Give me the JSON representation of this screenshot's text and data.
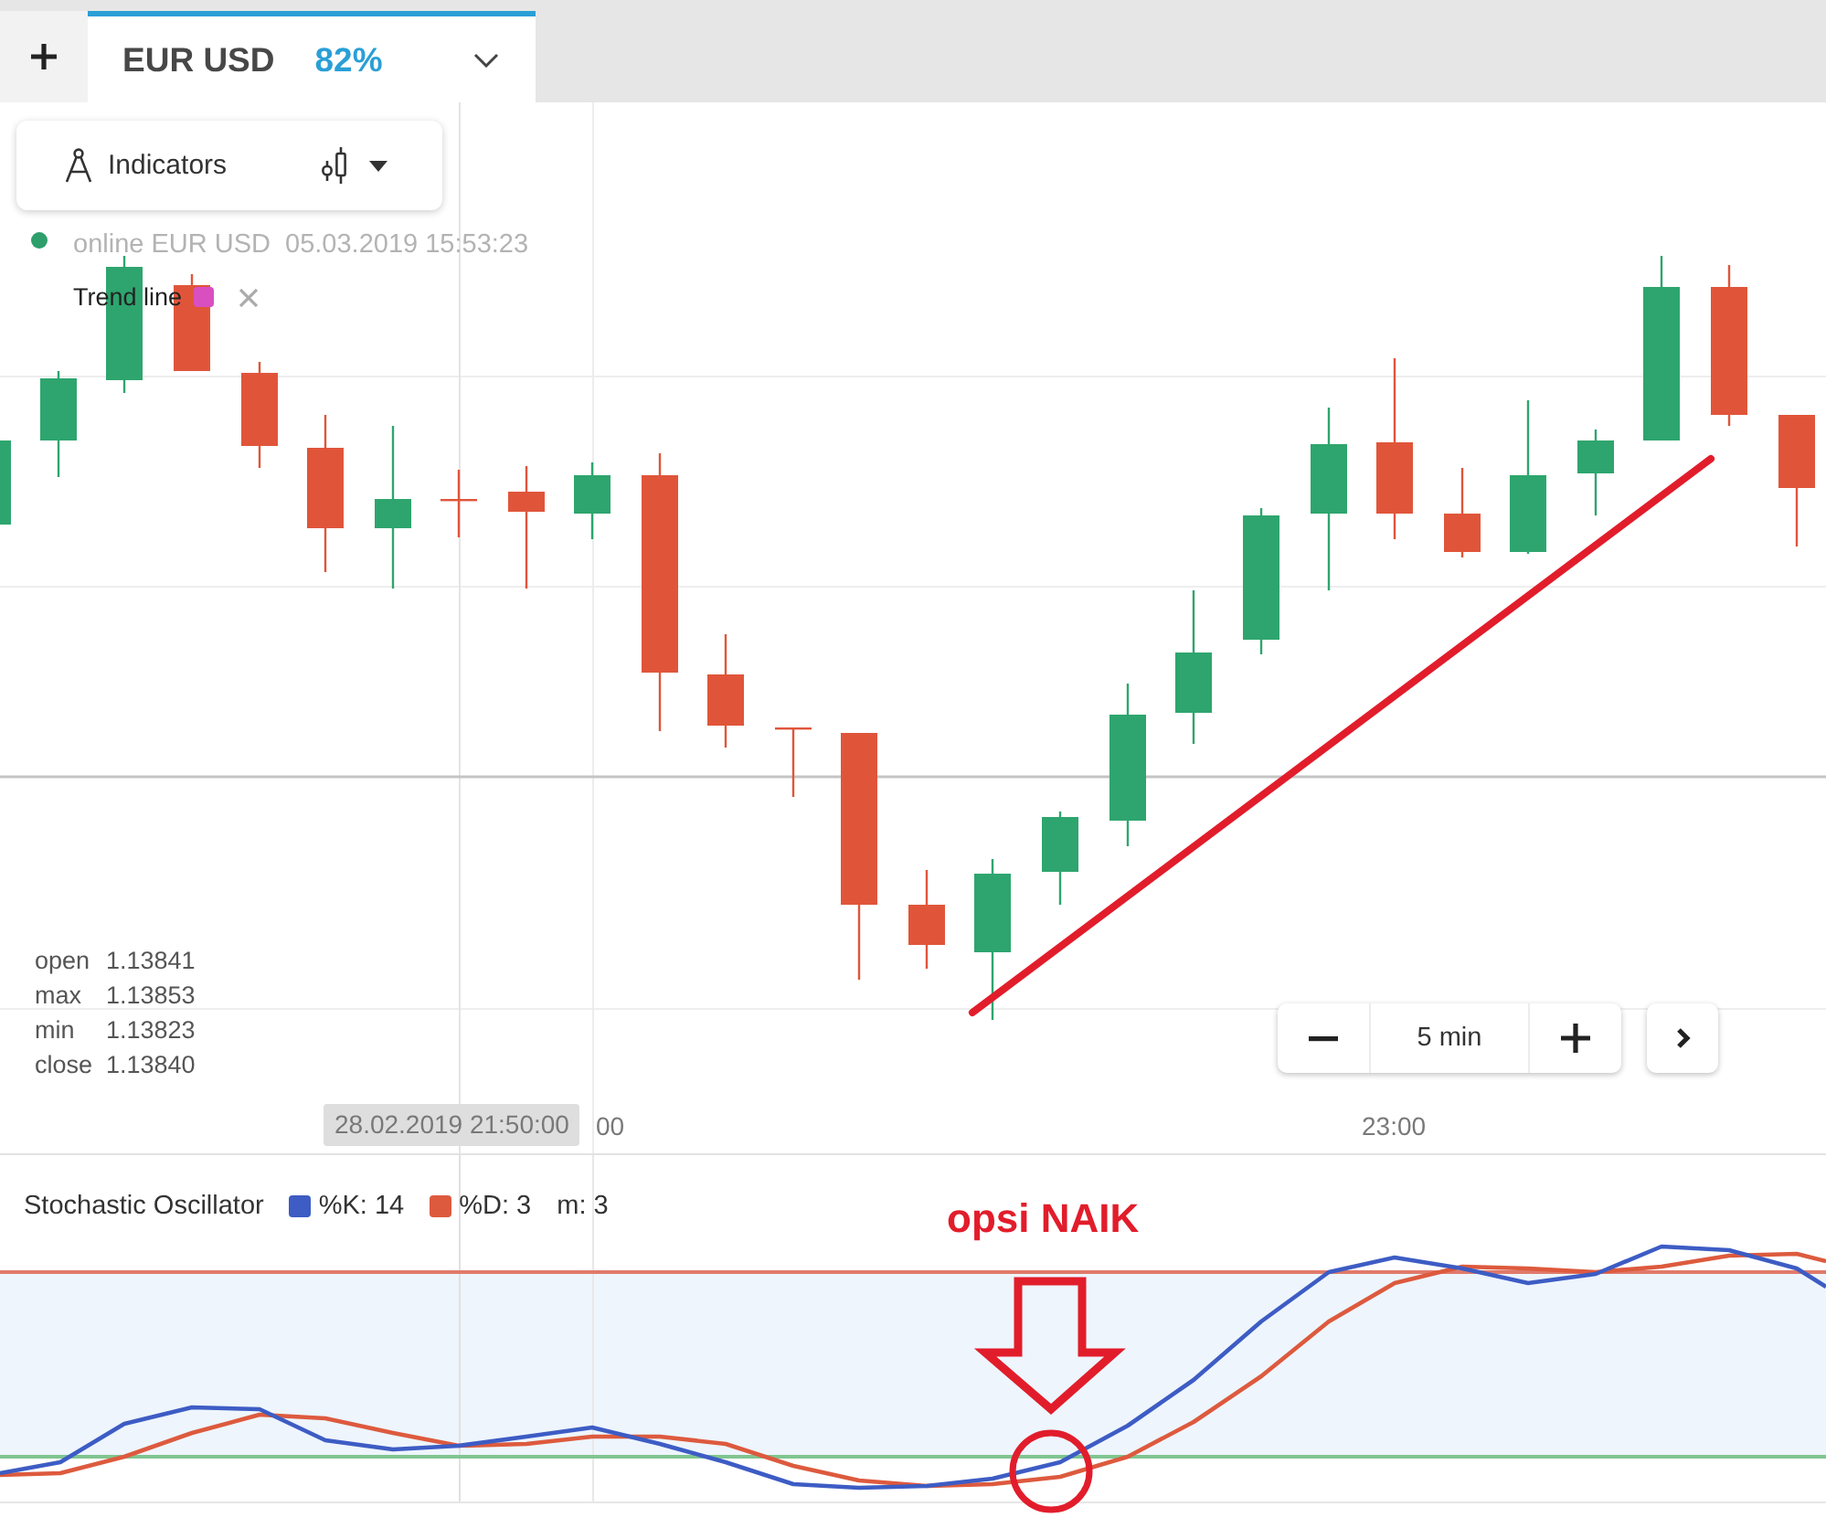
{
  "tab_bar": {
    "tabs": [
      {
        "symbol": "EUR USD",
        "payout": "82%",
        "selected": true
      }
    ]
  },
  "toolbar": {
    "indicators_label": "Indicators"
  },
  "legend": {
    "label": "online EUR USD",
    "timestamp": "05.03.2019 15:53:23"
  },
  "drawings": [
    {
      "label": "Trend line",
      "color": "#d94fc0"
    }
  ],
  "ohlc": [
    {
      "label": "open",
      "value": "1.13841"
    },
    {
      "label": "max",
      "value": "1.13853"
    },
    {
      "label": "min",
      "value": "1.13823"
    },
    {
      "label": "close",
      "value": "1.13840"
    }
  ],
  "time_axis": {
    "cursor_label": "28.02.2019 21:50:00",
    "ticks": [
      "00",
      "23:00"
    ]
  },
  "zoom": {
    "interval": "5 min"
  },
  "oscillator": {
    "title": "Stochastic Oscillator",
    "params": [
      {
        "label": "%K: 14",
        "color": "#3d5cc4"
      },
      {
        "label": "%D: 3",
        "color": "#dd5a3e"
      },
      {
        "label": "m: 3"
      }
    ]
  },
  "annotation": {
    "text": "opsi NAIK"
  }
}
